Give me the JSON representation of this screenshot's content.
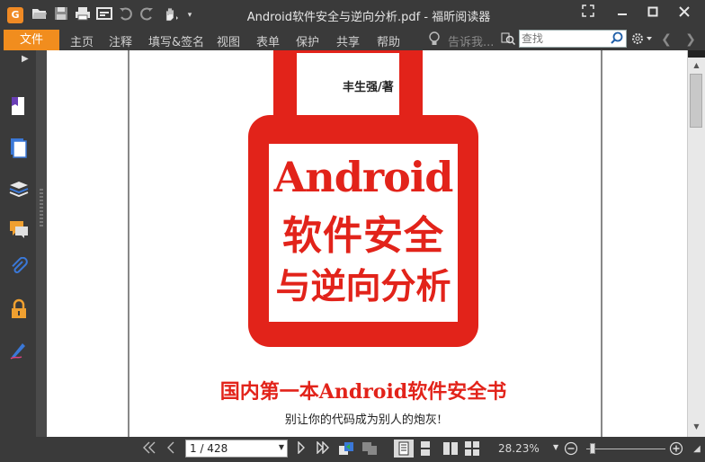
{
  "app": {
    "title": "Android软件安全与逆向分析.pdf - 福昕阅读器",
    "logo_letter": "G"
  },
  "quick_access": [
    "open-icon",
    "save-icon",
    "print-icon",
    "properties-icon",
    "undo-icon",
    "redo-icon",
    "hand-tool-icon",
    "customize-icon"
  ],
  "menu": {
    "file": "文件",
    "items": [
      "主页",
      "注释",
      "填写&签名",
      "视图",
      "表单",
      "保护",
      "共享",
      "帮助"
    ],
    "tell_me_placeholder": "告诉我...",
    "search_placeholder": "查找"
  },
  "left_panel": {
    "icons": [
      "bookmark-icon",
      "pages-icon",
      "layers-icon",
      "comments-icon",
      "attachments-icon",
      "security-icon",
      "signature-icon"
    ]
  },
  "document": {
    "author": "丰生强/著",
    "cover_title_line1": "Android",
    "cover_title_line2": "软件安全",
    "cover_title_line3": "与逆向分析",
    "tagline": "国内第一本Android软件安全书",
    "subtitle": "别让你的代码成为别人的炮灰!",
    "lock_color": "#e2231a"
  },
  "statusbar": {
    "page_display": "1 / 428",
    "zoom": "28.23%"
  },
  "colors": {
    "accent": "#f18d1e",
    "chrome": "#3a3a3a"
  }
}
